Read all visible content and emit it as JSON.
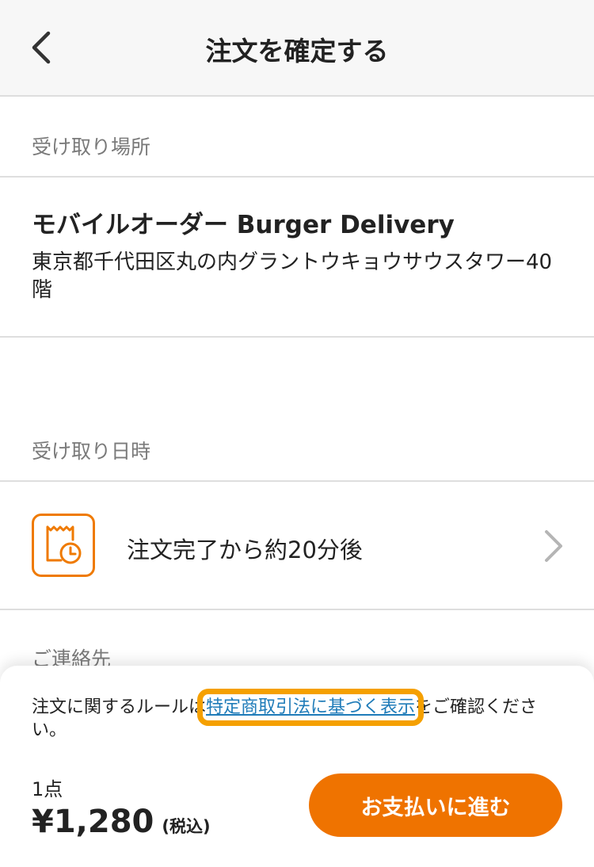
{
  "header": {
    "title": "注文を確定する",
    "back_icon": "chevron-left-icon"
  },
  "pickup_location": {
    "label": "受け取り場所",
    "store_name": "モバイルオーダー Burger Delivery",
    "address": "東京都千代田区丸の内グラントウキョウサウスタワー40階"
  },
  "pickup_time": {
    "label": "受け取り日時",
    "icon": "receipt-clock-icon",
    "value": "注文完了から約20分後",
    "chevron_icon": "chevron-right-icon"
  },
  "contact": {
    "label": "ご連絡先"
  },
  "bottom_sheet": {
    "notice_before": "注文に関するルールは",
    "notice_link": "特定商取引法に基づく表示",
    "notice_after": "をご確認ください。",
    "item_count": "1点",
    "total_price": "¥1,280",
    "tax_note": "(税込)",
    "pay_button_label": "お支払いに進む"
  },
  "colors": {
    "accent": "#ef7300",
    "link": "#1e7bb8",
    "highlight": "#f5a000",
    "header_bg": "#f7f7f7"
  }
}
